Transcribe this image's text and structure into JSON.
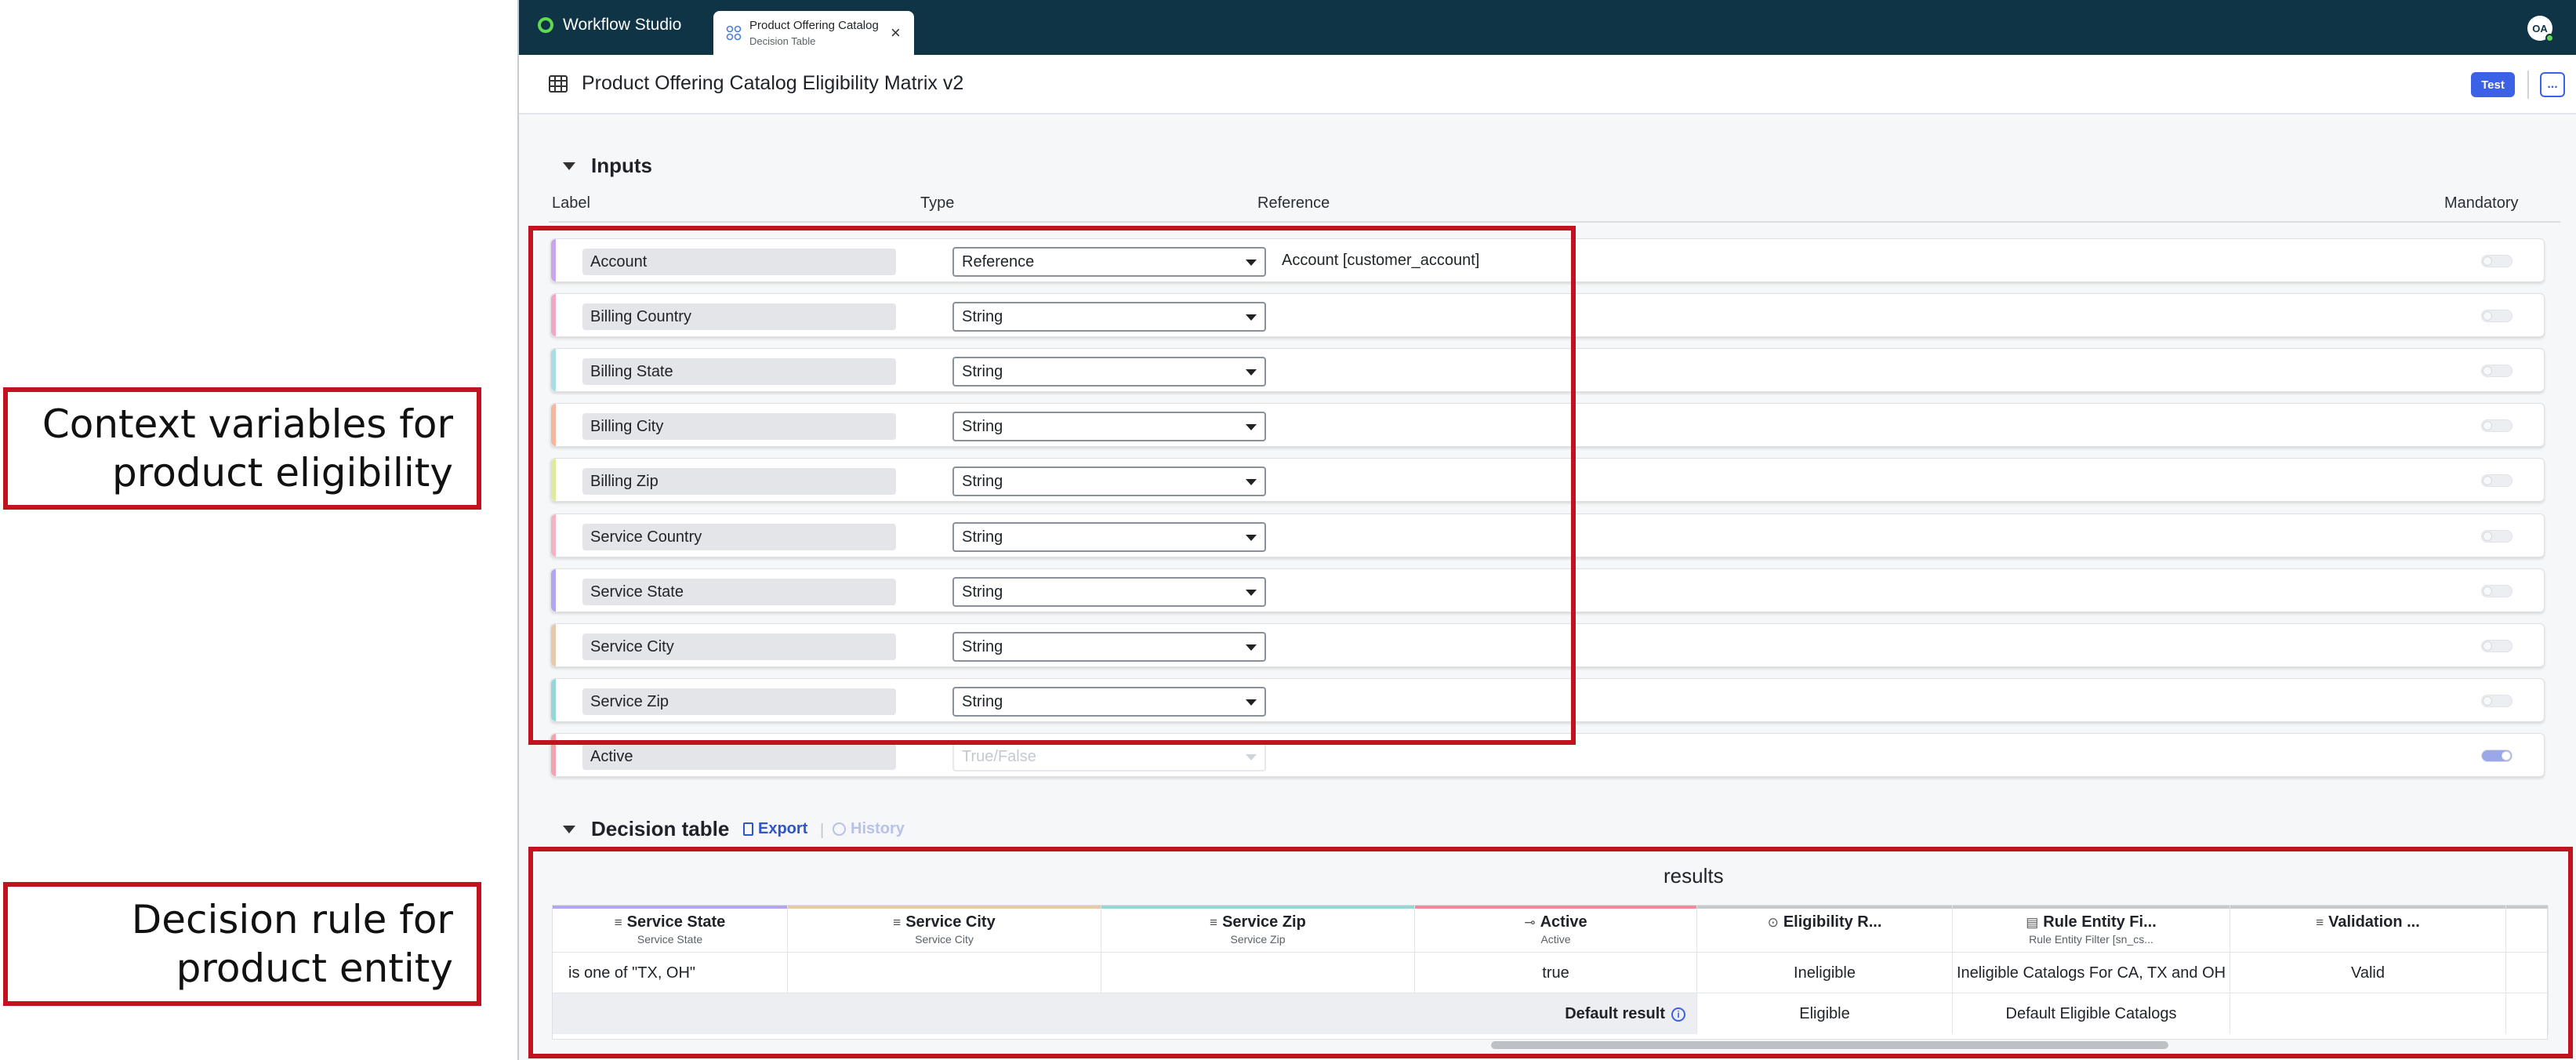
{
  "callouts": {
    "inputs": "Context variables for\nproduct eligibility",
    "decision": "Decision rule for\nproduct entity"
  },
  "topbar": {
    "brand": "Workflow Studio",
    "tab": {
      "title": "Product Offering Catalog",
      "subtitle": "Decision Table",
      "close_icon": "close-icon"
    },
    "avatar": "OA"
  },
  "header": {
    "title": "Product Offering Catalog Eligibility Matrix v2",
    "test_label": "Test",
    "more_label": "..."
  },
  "inputs": {
    "section_title": "Inputs",
    "columns": {
      "label": "Label",
      "type": "Type",
      "reference": "Reference",
      "mandatory": "Mandatory"
    },
    "rows": [
      {
        "label": "Account",
        "type": "Reference",
        "reference": "Account [customer_account]",
        "accent": "#c9a5ee",
        "mandatory": false
      },
      {
        "label": "Billing Country",
        "type": "String",
        "reference": "",
        "accent": "#f0a8c6",
        "mandatory": false
      },
      {
        "label": "Billing State",
        "type": "String",
        "reference": "",
        "accent": "#a8dde6",
        "mandatory": false
      },
      {
        "label": "Billing City",
        "type": "String",
        "reference": "",
        "accent": "#f4b79e",
        "mandatory": false
      },
      {
        "label": "Billing Zip",
        "type": "String",
        "reference": "",
        "accent": "#dfe9a0",
        "mandatory": false
      },
      {
        "label": "Service Country",
        "type": "String",
        "reference": "",
        "accent": "#f2b4c3",
        "mandatory": false
      },
      {
        "label": "Service State",
        "type": "String",
        "reference": "",
        "accent": "#b3a6ee",
        "mandatory": false
      },
      {
        "label": "Service City",
        "type": "String",
        "reference": "",
        "accent": "#e7c9a7",
        "mandatory": false
      },
      {
        "label": "Service Zip",
        "type": "String",
        "reference": "",
        "accent": "#95d7d6",
        "mandatory": false
      },
      {
        "label": "Active",
        "type": "True/False",
        "reference": "",
        "accent": "#f2a3ad",
        "mandatory": true,
        "disabled": true
      }
    ]
  },
  "decision_table": {
    "title": "Decision table",
    "export_label": "Export",
    "history_label": "History",
    "results_label": "results",
    "columns": [
      {
        "name": "Service State",
        "sub": "Service State",
        "bar": "#b3a6ee"
      },
      {
        "name": "Service City",
        "sub": "Service City",
        "bar": "#e7c9a7"
      },
      {
        "name": "Service Zip",
        "sub": "Service Zip",
        "bar": "#95d7d6"
      },
      {
        "name": "Active",
        "sub": "Active",
        "bar": "#f28b97"
      },
      {
        "name": "Eligibility R...",
        "sub": "",
        "bar": "#c5c9ce"
      },
      {
        "name": "Rule Entity Fi...",
        "sub": "Rule Entity Filter [sn_cs...",
        "bar": "#c5c9ce"
      },
      {
        "name": "Validation ...",
        "sub": "",
        "bar": "#c5c9ce"
      },
      {
        "name": "",
        "sub": "",
        "bar": "#c5c9ce"
      }
    ],
    "row": [
      "is one of \"TX, OH\"",
      "",
      "",
      "true",
      "Ineligible",
      "Ineligible Catalogs For CA, TX and OH",
      "Valid",
      ""
    ],
    "default_label": "Default result",
    "default_info": "i",
    "defaults": [
      "Eligible",
      "Default Eligible Catalogs",
      "",
      ""
    ]
  }
}
